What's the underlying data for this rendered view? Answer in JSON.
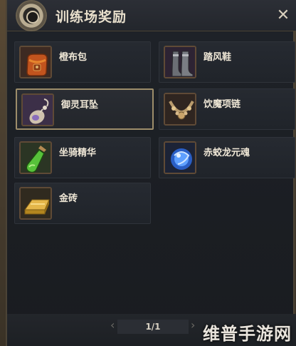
{
  "panel": {
    "title": "训练场奖励",
    "close_icon": "close-x-icon",
    "header_icon": "gear-emblem-icon"
  },
  "items": [
    {
      "name": "橙布包",
      "icon": "orange-bag-icon"
    },
    {
      "name": "踏风鞋",
      "icon": "boots-icon"
    },
    {
      "name": "御灵耳坠",
      "icon": "earring-icon"
    },
    {
      "name": "饮魔项链",
      "icon": "necklace-icon"
    },
    {
      "name": "坐骑精华",
      "icon": "green-potion-icon"
    },
    {
      "name": "赤蛟龙元魂",
      "icon": "blue-orb-icon"
    },
    {
      "name": "金砖",
      "icon": "gold-bar-icon"
    }
  ],
  "pager": {
    "text": "1/1"
  },
  "watermark": "维普手游网"
}
